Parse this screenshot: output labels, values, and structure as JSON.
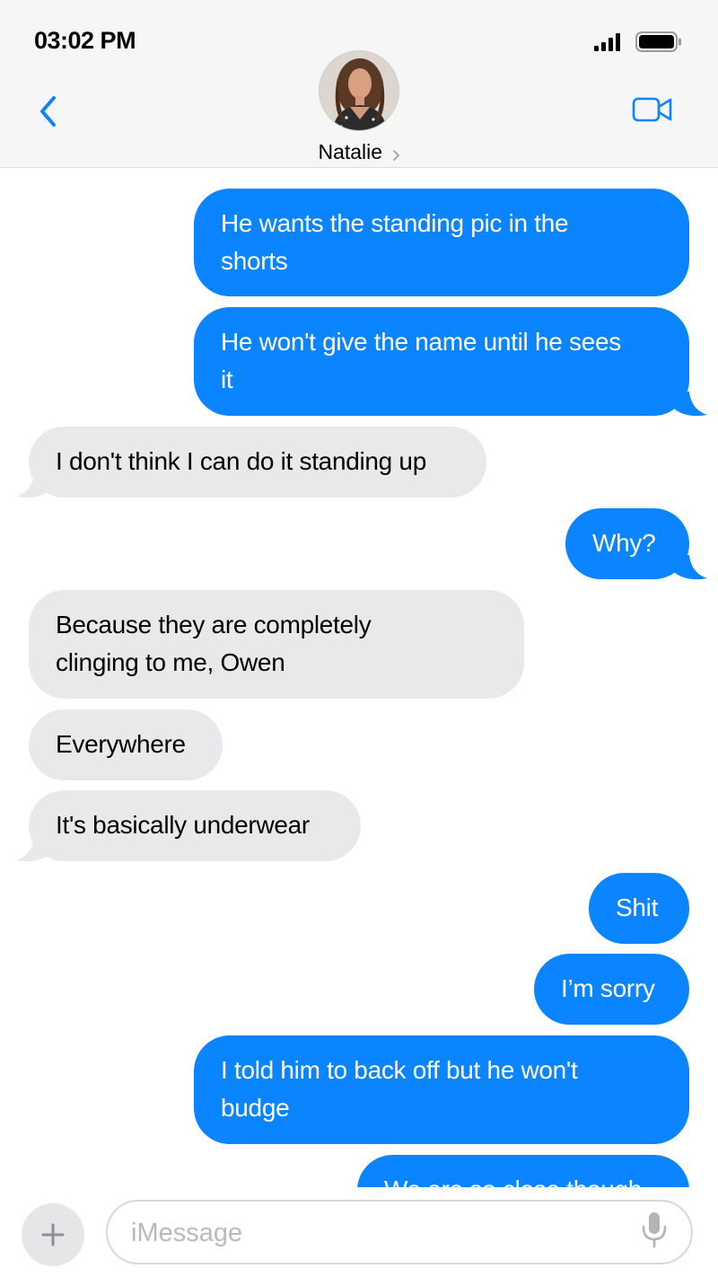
{
  "status_bar": {
    "time": "03:02 PM"
  },
  "header": {
    "contact_name": "Natalie",
    "icons": {
      "back": "chevron-left-icon",
      "video": "video-camera-icon",
      "name_chevron": "chevron-right-icon"
    }
  },
  "messages": [
    {
      "direction": "outgoing",
      "lines": [
        "He wants the standing pic in the",
        "shorts"
      ]
    },
    {
      "direction": "outgoing",
      "lines": [
        "He won't give the name until he sees",
        "it"
      ]
    },
    {
      "direction": "incoming",
      "lines": [
        "I don't think I can do it standing up"
      ]
    },
    {
      "direction": "outgoing",
      "lines": [
        "Why?"
      ]
    },
    {
      "direction": "incoming",
      "lines": [
        "Because they are completely",
        "clinging to me, Owen"
      ]
    },
    {
      "direction": "incoming",
      "lines": [
        "Everywhere"
      ]
    },
    {
      "direction": "incoming",
      "lines": [
        "It's basically underwear"
      ]
    },
    {
      "direction": "outgoing",
      "lines": [
        "Shit"
      ]
    },
    {
      "direction": "outgoing",
      "lines": [
        "I’m sorry"
      ]
    },
    {
      "direction": "outgoing",
      "lines": [
        "I told him to back off but he won't",
        "budge"
      ]
    },
    {
      "direction": "outgoing",
      "lines": [
        "We are so close though"
      ]
    }
  ],
  "composer": {
    "placeholder": "iMessage",
    "value": "",
    "icons": {
      "add": "plus-icon",
      "mic": "microphone-icon"
    }
  },
  "colors": {
    "outgoing_bubble": "#0a84ff",
    "incoming_bubble": "#e9e9eb",
    "header_bg": "#f6f6f6"
  }
}
